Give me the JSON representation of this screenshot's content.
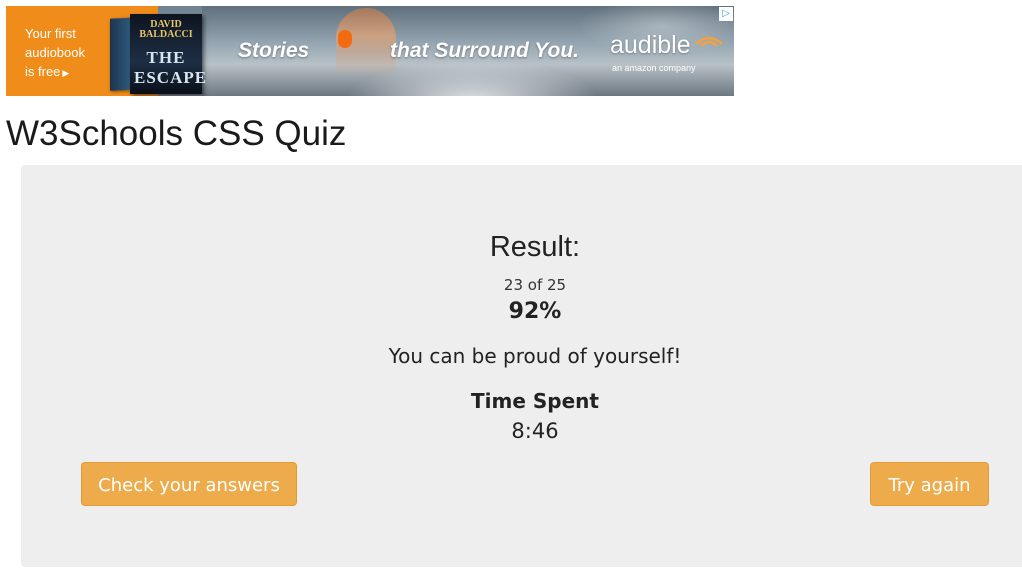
{
  "ad": {
    "cta_line1": "Your first",
    "cta_line2": "audiobook",
    "cta_line3": "is free",
    "cta_arrow": "▶",
    "book_author_line1": "DAVID",
    "book_author_line2": "BALDACCI",
    "book_title": "THE ESCAPE",
    "tagline_part1": "Stories",
    "tagline_part2": "that Surround You.",
    "brand": "audible",
    "brand_sub": "an amazon company",
    "adchoices_icon": "adchoices-icon",
    "orange": "#f08c1a"
  },
  "page": {
    "title": "W3Schools CSS Quiz"
  },
  "result": {
    "heading": "Result:",
    "score": "23 of 25",
    "percent": "92%",
    "message": "You can be proud of yourself!",
    "time_label": "Time Spent",
    "time_value": "8:46"
  },
  "buttons": {
    "check_answers": "Check your answers",
    "try_again": "Try again",
    "color": "#eeab4c"
  },
  "colors": {
    "panel_background": "#eeeeee"
  }
}
